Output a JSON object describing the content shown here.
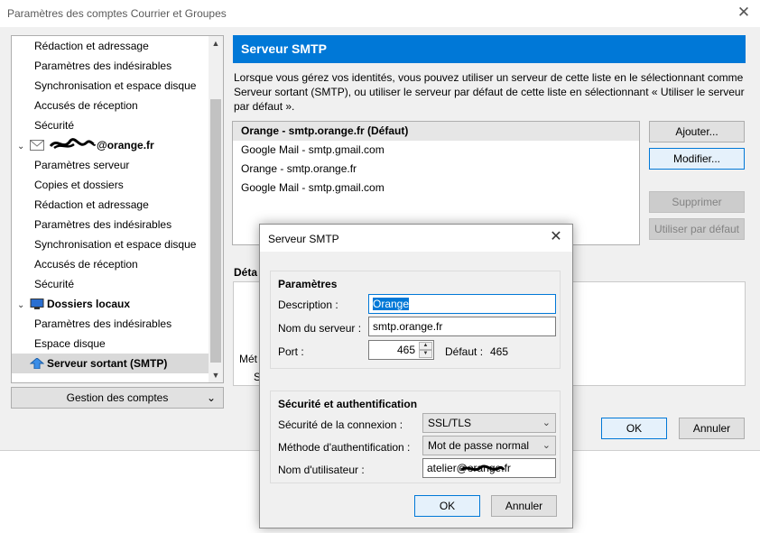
{
  "window": {
    "title": "Paramètres des comptes Courrier et Groupes"
  },
  "tree": {
    "rows": [
      {
        "label": "Rédaction et adressage"
      },
      {
        "label": "Paramètres des indésirables"
      },
      {
        "label": "Synchronisation et espace disque"
      },
      {
        "label": "Accusés de réception"
      },
      {
        "label": "Sécurité"
      },
      {
        "label": "@orange.fr",
        "icon": "mail-icon"
      },
      {
        "label": "Paramètres serveur"
      },
      {
        "label": "Copies et dossiers"
      },
      {
        "label": "Rédaction et adressage"
      },
      {
        "label": "Paramètres des indésirables"
      },
      {
        "label": "Synchronisation et espace disque"
      },
      {
        "label": "Accusés de réception"
      },
      {
        "label": "Sécurité"
      },
      {
        "label": "Dossiers locaux",
        "icon": "computer-icon"
      },
      {
        "label": "Paramètres des indésirables"
      },
      {
        "label": "Espace disque"
      },
      {
        "label": "Serveur sortant (SMTP)",
        "icon": "outgoing-server-icon"
      }
    ],
    "manage_button": "Gestion des comptes"
  },
  "panel": {
    "header": "Serveur SMTP",
    "description": "Lorsque vous gérez vos identités, vous pouvez utiliser un serveur de cette liste en le sélectionnant comme Serveur sortant (SMTP), ou utiliser le serveur par défaut de cette liste en sélectionnant « Utiliser le serveur par défaut ».",
    "servers": [
      "Orange - smtp.orange.fr (Défaut)",
      "Google Mail - smtp.gmail.com",
      "Orange - smtp.orange.fr",
      "Google Mail - smtp.gmail.com"
    ],
    "buttons": {
      "add": "Ajouter...",
      "modify": "Modifier...",
      "delete": "Supprimer",
      "set_default": "Utiliser par défaut"
    },
    "details_label": "Déta",
    "details_frag_1": "Mét",
    "details_frag_2": "S",
    "ok": "OK",
    "cancel": "Annuler"
  },
  "dialog": {
    "title": "Serveur SMTP",
    "params_title": "Paramètres",
    "description_label": "Description :",
    "description_value": "Orange",
    "server_name_label": "Nom du serveur :",
    "server_name_value": "smtp.orange.fr",
    "port_label": "Port :",
    "port_value": "465",
    "default_label": "Défaut :",
    "default_value": "465",
    "security_title": "Sécurité et authentification",
    "connection_security_label": "Sécurité de la connexion :",
    "connection_security_value": "SSL/TLS",
    "auth_method_label": "Méthode d'authentification :",
    "auth_method_value": "Mot de passe normal",
    "username_label": "Nom d'utilisateur :",
    "username_value": "atelier@orange.fr",
    "ok": "OK",
    "cancel": "Annuler"
  },
  "colors": {
    "accent": "#0078d7",
    "window_bg": "#f0f0f0",
    "selection_bg": "#d9d9d9"
  }
}
